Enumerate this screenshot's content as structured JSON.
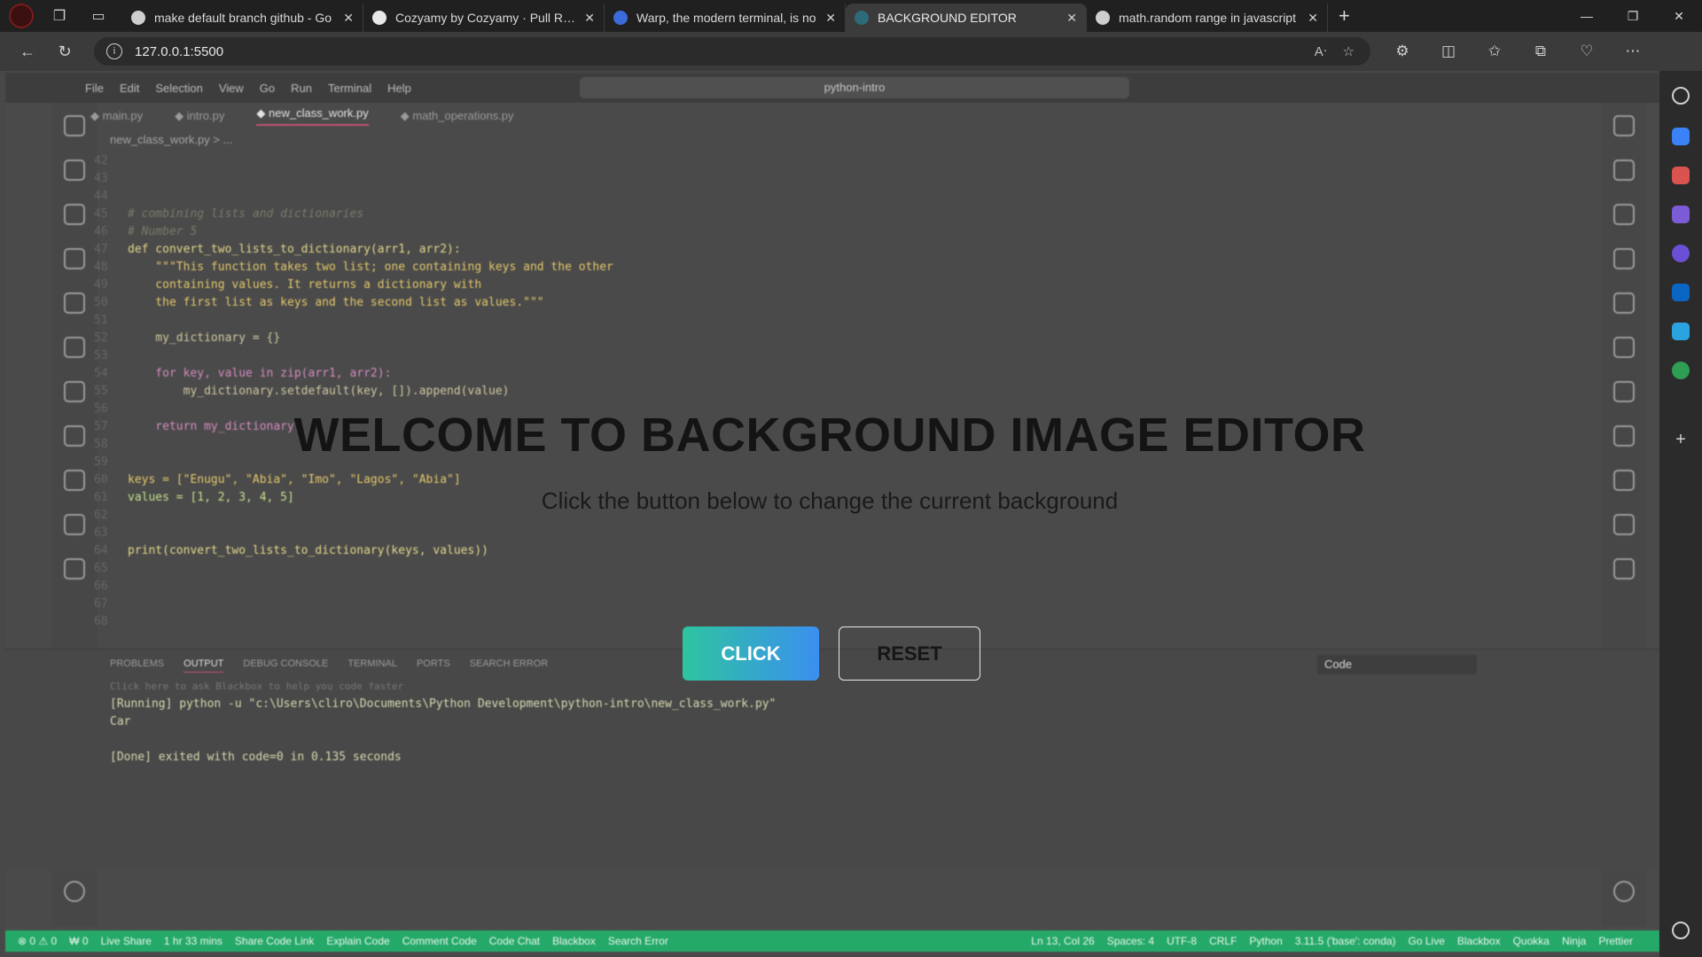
{
  "browser": {
    "tabs": [
      {
        "title": "make default branch github - Go",
        "icon_color": "#cfcfcf"
      },
      {
        "title": "Cozyamy by Cozyamy · Pull Requ",
        "icon_color": "#e8e8e8"
      },
      {
        "title": "Warp, the modern terminal, is no",
        "icon_color": "#3a6bd8"
      },
      {
        "title": "BACKGROUND EDITOR",
        "icon_color": "#2d6b7a",
        "active": true
      },
      {
        "title": "math.random range in javascript",
        "icon_color": "#cfcfcf"
      }
    ],
    "url": "127.0.0.1:5500"
  },
  "vscode": {
    "menu": [
      "File",
      "Edit",
      "Selection",
      "View",
      "Go",
      "Run",
      "Terminal",
      "Help"
    ],
    "command_center": "python-intro",
    "editor_tabs": [
      "main.py",
      "intro.py",
      "new_class_work.py",
      "math_operations.py"
    ],
    "breadcrumb": "new_class_work.py > ...",
    "code_lines": [
      {
        "n": "42",
        "t": ""
      },
      {
        "n": "43",
        "t": ""
      },
      {
        "n": "44",
        "t": ""
      },
      {
        "n": "45",
        "t": "# combining lists and dictionaries",
        "c": "cm"
      },
      {
        "n": "46",
        "t": "# Number 5",
        "c": "cm"
      },
      {
        "n": "47",
        "t": "def convert_two_lists_to_dictionary(arr1, arr2):",
        "c": "fn"
      },
      {
        "n": "48",
        "t": "    \"\"\"This function takes two list; one containing keys and the other",
        "c": "st"
      },
      {
        "n": "49",
        "t": "    containing values. It returns a dictionary with",
        "c": "st"
      },
      {
        "n": "50",
        "t": "    the first list as keys and the second list as values.\"\"\"",
        "c": "st"
      },
      {
        "n": "51",
        "t": ""
      },
      {
        "n": "52",
        "t": "    my_dictionary = {}"
      },
      {
        "n": "53",
        "t": ""
      },
      {
        "n": "54",
        "t": "    for key, value in zip(arr1, arr2):",
        "c": "kw"
      },
      {
        "n": "55",
        "t": "        my_dictionary.setdefault(key, []).append(value)"
      },
      {
        "n": "56",
        "t": ""
      },
      {
        "n": "57",
        "t": "    return my_dictionary",
        "c": "kw"
      },
      {
        "n": "58",
        "t": ""
      },
      {
        "n": "59",
        "t": ""
      },
      {
        "n": "60",
        "t": "keys = [\"Enugu\", \"Abia\", \"Imo\", \"Lagos\", \"Abia\"]",
        "c": "st"
      },
      {
        "n": "61",
        "t": "values = [1, 2, 3, 4, 5]",
        "c": "num"
      },
      {
        "n": "62",
        "t": ""
      },
      {
        "n": "63",
        "t": ""
      },
      {
        "n": "64",
        "t": "print(convert_two_lists_to_dictionary(keys, values))",
        "c": "fn"
      },
      {
        "n": "65",
        "t": ""
      },
      {
        "n": "66",
        "t": ""
      },
      {
        "n": "67",
        "t": ""
      },
      {
        "n": "68",
        "t": ""
      }
    ],
    "panel_tabs": [
      "PROBLEMS",
      "OUTPUT",
      "DEBUG CONSOLE",
      "TERMINAL",
      "PORTS",
      "SEARCH ERROR"
    ],
    "panel_select": "Code",
    "output_lines": [
      {
        "t": "Click here to ask Blackbox to help you code faster",
        "c": "muted"
      },
      {
        "t": "[Running] python -u \"c:\\Users\\cliro\\Documents\\Python Development\\python-intro\\new_class_work.py\""
      },
      {
        "t": "Car"
      },
      {
        "t": ""
      },
      {
        "t": "[Done] exited with code=0 in 0.135 seconds"
      }
    ],
    "status_left": [
      "⊗ 0 ⚠ 0",
      "₩ 0",
      "Live Share",
      "1 hr 33 mins",
      "Share Code Link",
      "Explain Code",
      "Comment Code",
      "Code Chat",
      "Blackbox",
      "Search Error"
    ],
    "status_right": [
      "Ln 13, Col 26",
      "Spaces: 4",
      "UTF-8",
      "CRLF",
      "Python",
      "3.11.5 ('base': conda)",
      "Go Live",
      "Blackbox",
      "Quokka",
      "Ninja",
      "Prettier"
    ]
  },
  "app": {
    "title": "WELCOME TO BACKGROUND IMAGE EDITOR",
    "subtitle": "Click the button below to change the current background",
    "click_button": "CLICK",
    "reset_button": "RESET"
  },
  "colors": {
    "click_gradient_start": "#2ec4a0",
    "click_gradient_end": "#3b8ff0",
    "status_bar": "#25a968"
  }
}
